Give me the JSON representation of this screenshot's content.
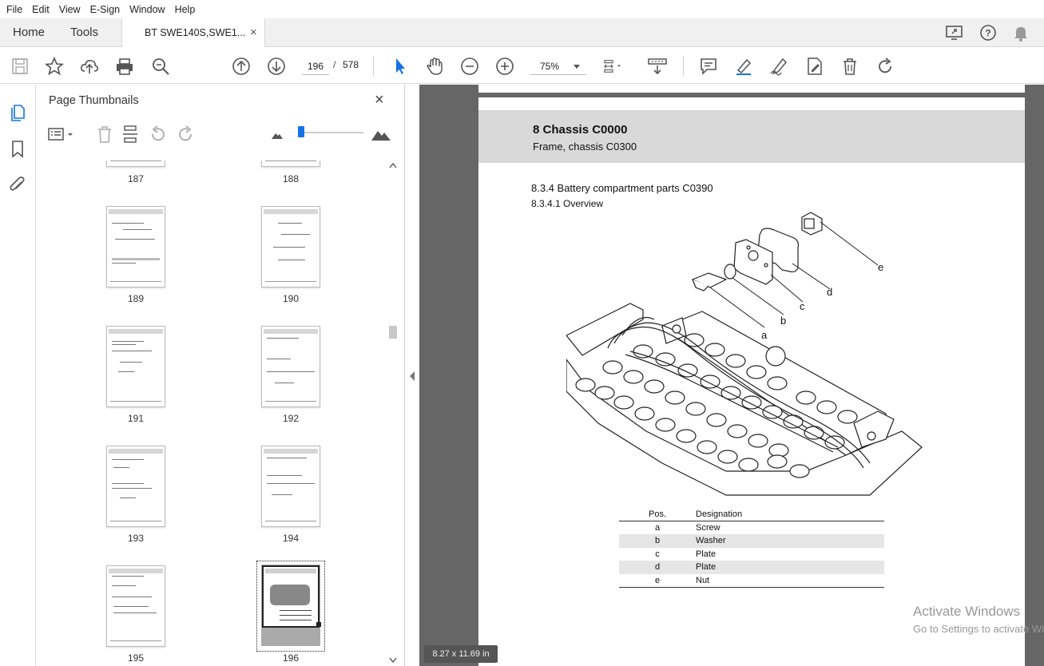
{
  "menu": [
    "File",
    "Edit",
    "View",
    "E-Sign",
    "Window",
    "Help"
  ],
  "tabs": {
    "home": "Home",
    "tools": "Tools",
    "document": "BT SWE140S,SWE1...",
    "close": "×"
  },
  "toolbar": {
    "current_page": "196",
    "separator": "/",
    "total_pages": "578",
    "zoom": "75%"
  },
  "panel": {
    "title": "Page Thumbnails",
    "close": "×",
    "thumbnails": [
      {
        "label": "187"
      },
      {
        "label": "188"
      },
      {
        "label": "189"
      },
      {
        "label": "190"
      },
      {
        "label": "191"
      },
      {
        "label": "192"
      },
      {
        "label": "193"
      },
      {
        "label": "194"
      },
      {
        "label": "195"
      },
      {
        "label": "196",
        "selected": true
      }
    ]
  },
  "document": {
    "chapter": "8 Chassis C0000",
    "subchapter": "Frame, chassis C0300",
    "section": "8.3.4 Battery compartment parts C0390",
    "subsection": "8.3.4.1 Overview",
    "callouts": [
      "a",
      "b",
      "c",
      "d",
      "e"
    ],
    "parts_table": {
      "headers": [
        "Pos.",
        "Designation"
      ],
      "rows": [
        {
          "pos": "a",
          "designation": "Screw"
        },
        {
          "pos": "b",
          "designation": "Washer"
        },
        {
          "pos": "c",
          "designation": "Plate"
        },
        {
          "pos": "d",
          "designation": "Plate"
        },
        {
          "pos": "e",
          "designation": "Nut"
        }
      ]
    },
    "page_size": "8.27 x 11.69 in"
  },
  "watermark": {
    "line1": "Activate Windows",
    "line2": "Go to Settings to activate Windows."
  },
  "colors": {
    "accent": "#1473e6",
    "doc_background": "#666666",
    "header_band": "#d9d9d9"
  }
}
